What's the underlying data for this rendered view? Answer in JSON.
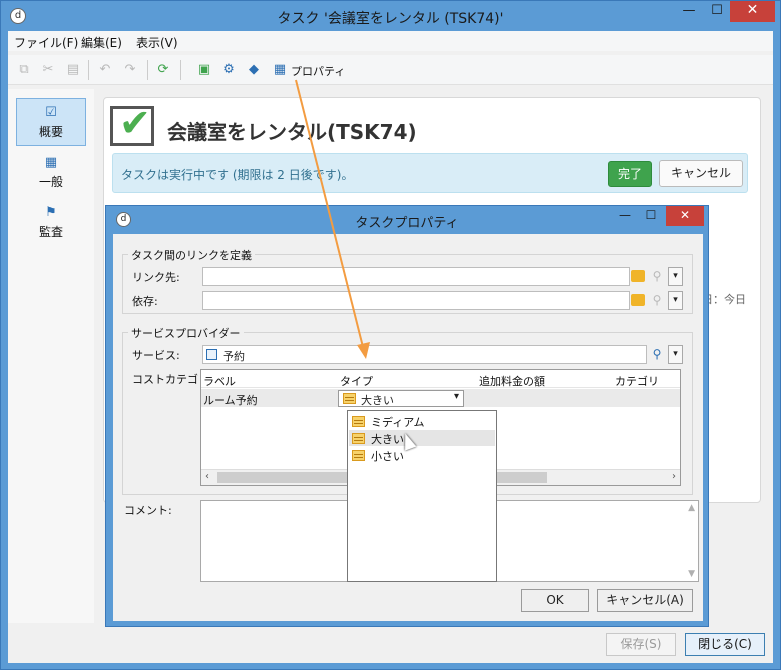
{
  "window": {
    "app_icon": "d-icon",
    "title": "タスク '会議室をレンタル (TSK74)'",
    "min_glyph": "—",
    "max_glyph": "☐",
    "close_glyph": "✕"
  },
  "menu": [
    "ファイル(F)",
    "編集(E)",
    "表示(V)"
  ],
  "toolbar": {
    "properties_label": "プロパティ",
    "icons": [
      "copy-icon",
      "cut-icon",
      "paste-icon",
      "undo-icon",
      "redo-icon",
      "refresh-icon",
      "calculator-icon",
      "gear-icon",
      "tag-icon",
      "clipboard-icon"
    ]
  },
  "nav": {
    "items": [
      {
        "label": "概要",
        "icon": "checkbox-icon"
      },
      {
        "label": "一般",
        "icon": "clipboard-icon"
      },
      {
        "label": "監査",
        "icon": "audit-icon"
      }
    ]
  },
  "task": {
    "title": "会議室をレンタル(TSK74)",
    "status": "タスクは実行中です (期限は 2 日後です)。",
    "done_label": "完了",
    "cancel_label": "キャンセル",
    "side_today": "日：今日"
  },
  "footer": {
    "save_label": "保存(S)",
    "close_label": "閉じる(C)"
  },
  "dialog": {
    "title": "タスクプロパティ",
    "link_group": {
      "title": "タスク間のリンクを定義",
      "link_to_label": "リンク先:",
      "depends_label": "依存:"
    },
    "service_group": {
      "title": "サービスプロバイダー",
      "service_label": "サービス:",
      "service_value": "予約",
      "cost_label": "コストカテゴリ:",
      "columns": [
        "ラベル",
        "タイプ",
        "追加料金の額",
        "カテゴリ"
      ],
      "rows": [
        {
          "label": "ルーム予約",
          "type": "大きい"
        }
      ],
      "dropdown_options": [
        "ミディアム",
        "大きい",
        "小さい"
      ]
    },
    "comment_label": "コメント:",
    "ok_label": "OK",
    "cancel_label": "キャンセル(A)"
  },
  "colors": {
    "title_bar": "#5b9bd5",
    "close_red": "#c7413a",
    "done_green": "#3fa34d",
    "info_blue": "#d9edf7",
    "annotation_orange": "#f39c41"
  }
}
